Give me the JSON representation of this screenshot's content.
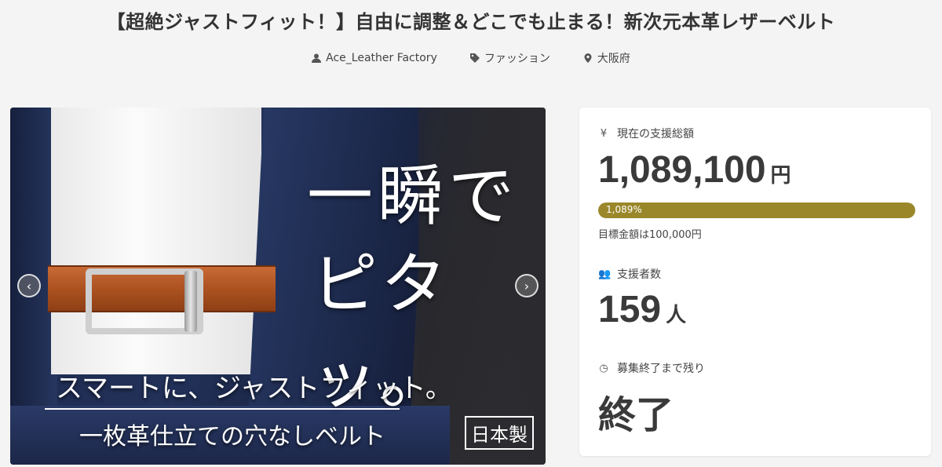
{
  "header": {
    "title": "【超絶ジャストフィット！】自由に調整＆どこでも止まる！新次元本革レザーベルト",
    "owner": "Ace_Leather Factory",
    "category": "ファッション",
    "location": "大阪府"
  },
  "hero": {
    "headline_line1": "一瞬で",
    "headline_line2": "ピタッ。",
    "subtitle": "スマートに、ジャストフィット。",
    "tagline": "一枚革仕立ての穴なしベルト",
    "badge": "日本製",
    "prev_icon": "chevron-left-icon",
    "next_icon": "chevron-right-icon"
  },
  "stats": {
    "total_label": "現在の支援総額",
    "total_icon": "yen-icon",
    "total_value": "1,089,100",
    "total_unit": "円",
    "progress_text": "1,089%",
    "progress_percent": 1089,
    "goal_text": "目標金額は100,000円",
    "supporters_label": "支援者数",
    "supporters_icon": "users-icon",
    "supporters_value": "159",
    "supporters_unit": "人",
    "remaining_label": "募集終了まで残り",
    "remaining_icon": "clock-icon",
    "remaining_value": "終了"
  },
  "colors": {
    "progress_fill": "#9a8729",
    "background": "#f4f4f4"
  }
}
